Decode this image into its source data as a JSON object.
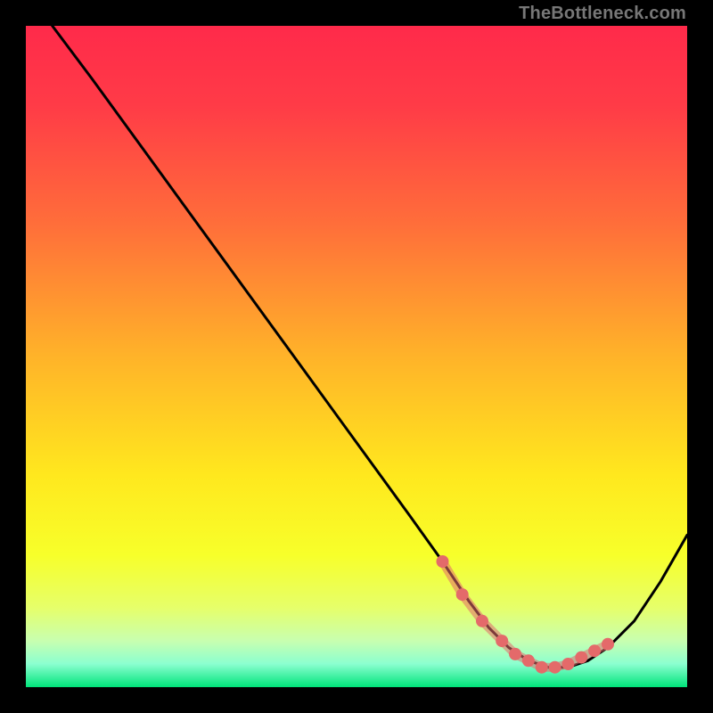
{
  "attribution": "TheBottleneck.com",
  "chart_data": {
    "type": "line",
    "title": "",
    "xlabel": "",
    "ylabel": "",
    "xlim": [
      0,
      100
    ],
    "ylim": [
      0,
      100
    ],
    "grid": false,
    "legend": false,
    "gradient_stops": [
      {
        "offset": 0.0,
        "color": "#ff2a4a"
      },
      {
        "offset": 0.12,
        "color": "#ff3b47"
      },
      {
        "offset": 0.3,
        "color": "#ff6e3a"
      },
      {
        "offset": 0.5,
        "color": "#ffb329"
      },
      {
        "offset": 0.68,
        "color": "#ffe81e"
      },
      {
        "offset": 0.8,
        "color": "#f7ff2a"
      },
      {
        "offset": 0.88,
        "color": "#e6ff6a"
      },
      {
        "offset": 0.93,
        "color": "#c8ffb0"
      },
      {
        "offset": 0.965,
        "color": "#8bffd0"
      },
      {
        "offset": 1.0,
        "color": "#00e47a"
      }
    ],
    "series": [
      {
        "name": "bottleneck-curve",
        "type": "line",
        "color": "#000000",
        "x": [
          4,
          10,
          18,
          26,
          34,
          42,
          50,
          58,
          63,
          67,
          70,
          73,
          76,
          79,
          82,
          85,
          88,
          92,
          96,
          100
        ],
        "values": [
          100,
          92,
          81,
          70,
          59,
          48,
          37,
          26,
          19,
          13,
          9,
          6,
          4,
          3,
          3,
          4,
          6,
          10,
          16,
          23
        ]
      },
      {
        "name": "optimal-band-markers",
        "type": "scatter",
        "color": "#e46a6a",
        "x": [
          63,
          66,
          69,
          72,
          74,
          76,
          78,
          80,
          82,
          84,
          86,
          88
        ],
        "values": [
          19,
          14,
          10,
          7,
          5,
          4,
          3,
          3,
          3.5,
          4.5,
          5.5,
          6.5
        ]
      }
    ],
    "optimal_range_x": [
      63,
      88
    ]
  }
}
